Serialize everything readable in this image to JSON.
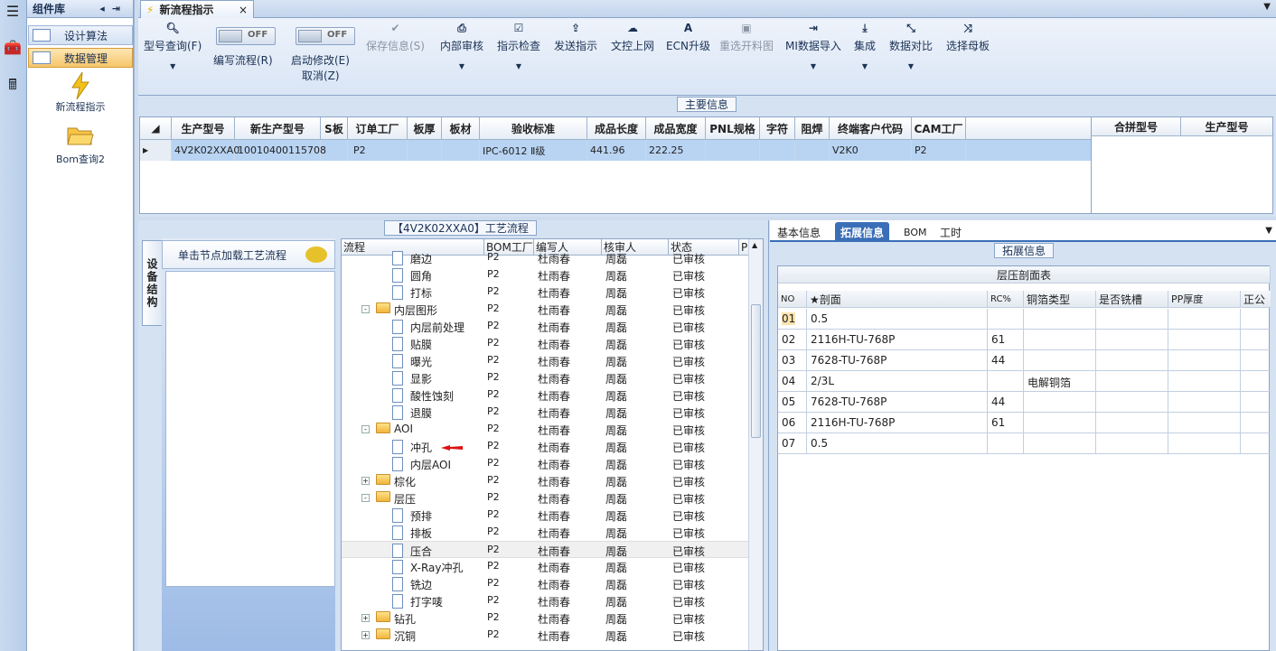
{
  "rail": {
    "icons": [
      "menu-icon",
      "toolbox-icon",
      "calculator-icon"
    ]
  },
  "components": {
    "title": "组件库",
    "nav": [
      {
        "label": "设计算法"
      },
      {
        "label": "数据管理"
      }
    ],
    "tools": [
      {
        "label": "新流程指示",
        "icon": "lightning-icon"
      },
      {
        "label": "Bom查询2",
        "icon": "folder-open-icon"
      }
    ]
  },
  "doc_tab": {
    "title": "新流程指示",
    "close": "×"
  },
  "ribbon": {
    "model_query": "型号查询(F)",
    "edit_toggle": {
      "state": "OFF",
      "label": "编写流程(R)"
    },
    "start_toggle": {
      "state": "OFF",
      "label": "启动修改(E)",
      "label2": "取消(Z)"
    },
    "buttons": [
      {
        "label": "保存信息(S)",
        "icon": "check-icon",
        "enabled": false
      },
      {
        "label": "内部审核",
        "icon": "printer-icon",
        "enabled": true
      },
      {
        "label": "指示检查",
        "icon": "checkbox-icon",
        "enabled": true
      },
      {
        "label": "发送指示",
        "icon": "upload-icon",
        "enabled": true
      },
      {
        "label": "文控上网",
        "icon": "cloud-icon",
        "enabled": true
      },
      {
        "label": "ECN升级",
        "icon": "ecn-icon",
        "enabled": true
      },
      {
        "label": "重选开料图",
        "icon": "image-icon",
        "enabled": false
      },
      {
        "label": "MI数据导入",
        "icon": "import-icon",
        "enabled": true
      },
      {
        "label": "集成",
        "icon": "download-icon",
        "enabled": true
      },
      {
        "label": "数据对比",
        "icon": "compare-icon",
        "enabled": true
      },
      {
        "label": "选择母板",
        "icon": "shuffle-icon",
        "enabled": true
      }
    ]
  },
  "main_info": {
    "title": "主要信息",
    "columns": [
      "生产型号",
      "新生产型号",
      "S板",
      "订单工厂",
      "板厚",
      "板材",
      "验收标准",
      "成品长度",
      "成品宽度",
      "PNL规格",
      "字符",
      "阻焊",
      "终端客户代码",
      "CAM工厂"
    ],
    "row": [
      "4V2K02XXA0",
      "10010400115708",
      "",
      "P2",
      "",
      "",
      "IPC-6012 Ⅱ级",
      "441.96",
      "222.25",
      "",
      "",
      "",
      "V2K0",
      "P2"
    ],
    "side_columns": [
      "合拼型号",
      "生产型号"
    ]
  },
  "process": {
    "title": "【4V2K02XXA0】工艺流程",
    "vtab": "设备结构",
    "load_btn": "单击节点加载工艺流程",
    "columns": [
      "流程",
      "BOM工厂",
      "编写人",
      "核审人",
      "状态",
      "P"
    ],
    "rows": [
      {
        "name": "磨边",
        "level": 2,
        "type": "doc",
        "factory": "P2",
        "writer": "杜雨春",
        "reviewer": "周磊",
        "status": "已审核"
      },
      {
        "name": "圆角",
        "level": 2,
        "type": "doc",
        "factory": "P2",
        "writer": "杜雨春",
        "reviewer": "周磊",
        "status": "已审核"
      },
      {
        "name": "打标",
        "level": 2,
        "type": "doc",
        "factory": "P2",
        "writer": "杜雨春",
        "reviewer": "周磊",
        "status": "已审核"
      },
      {
        "name": "内层图形",
        "level": 1,
        "type": "folder",
        "exp": "-",
        "factory": "P2",
        "writer": "杜雨春",
        "reviewer": "周磊",
        "status": "已审核"
      },
      {
        "name": "内层前处理",
        "level": 2,
        "type": "doc",
        "factory": "P2",
        "writer": "杜雨春",
        "reviewer": "周磊",
        "status": "已审核"
      },
      {
        "name": "贴膜",
        "level": 2,
        "type": "doc",
        "factory": "P2",
        "writer": "杜雨春",
        "reviewer": "周磊",
        "status": "已审核"
      },
      {
        "name": "曝光",
        "level": 2,
        "type": "doc",
        "factory": "P2",
        "writer": "杜雨春",
        "reviewer": "周磊",
        "status": "已审核"
      },
      {
        "name": "显影",
        "level": 2,
        "type": "doc",
        "factory": "P2",
        "writer": "杜雨春",
        "reviewer": "周磊",
        "status": "已审核"
      },
      {
        "name": "酸性蚀刻",
        "level": 2,
        "type": "doc",
        "factory": "P2",
        "writer": "杜雨春",
        "reviewer": "周磊",
        "status": "已审核"
      },
      {
        "name": "退膜",
        "level": 2,
        "type": "doc",
        "factory": "P2",
        "writer": "杜雨春",
        "reviewer": "周磊",
        "status": "已审核"
      },
      {
        "name": "AOI",
        "level": 1,
        "type": "folder",
        "exp": "-",
        "factory": "P2",
        "writer": "杜雨春",
        "reviewer": "周磊",
        "status": "已审核"
      },
      {
        "name": "冲孔",
        "level": 2,
        "type": "doc",
        "factory": "P2",
        "writer": "杜雨春",
        "reviewer": "周磊",
        "status": "已审核"
      },
      {
        "name": "内层AOI",
        "level": 2,
        "type": "doc",
        "factory": "P2",
        "writer": "杜雨春",
        "reviewer": "周磊",
        "status": "已审核"
      },
      {
        "name": "棕化",
        "level": 1,
        "type": "folder",
        "exp": "+",
        "factory": "P2",
        "writer": "杜雨春",
        "reviewer": "周磊",
        "status": "已审核"
      },
      {
        "name": "层压",
        "level": 1,
        "type": "folder",
        "exp": "-",
        "factory": "P2",
        "writer": "杜雨春",
        "reviewer": "周磊",
        "status": "已审核"
      },
      {
        "name": "预排",
        "level": 2,
        "type": "doc",
        "factory": "P2",
        "writer": "杜雨春",
        "reviewer": "周磊",
        "status": "已审核"
      },
      {
        "name": "排板",
        "level": 2,
        "type": "doc",
        "factory": "P2",
        "writer": "杜雨春",
        "reviewer": "周磊",
        "status": "已审核"
      },
      {
        "name": "压合",
        "level": 2,
        "type": "doc",
        "factory": "P2",
        "writer": "杜雨春",
        "reviewer": "周磊",
        "status": "已审核",
        "selected": true
      },
      {
        "name": "X-Ray冲孔",
        "level": 2,
        "type": "doc",
        "factory": "P2",
        "writer": "杜雨春",
        "reviewer": "周磊",
        "status": "已审核"
      },
      {
        "name": "铣边",
        "level": 2,
        "type": "doc",
        "factory": "P2",
        "writer": "杜雨春",
        "reviewer": "周磊",
        "status": "已审核"
      },
      {
        "name": "打字唛",
        "level": 2,
        "type": "doc",
        "factory": "P2",
        "writer": "杜雨春",
        "reviewer": "周磊",
        "status": "已审核"
      },
      {
        "name": "钻孔",
        "level": 1,
        "type": "folder",
        "exp": "+",
        "factory": "P2",
        "writer": "杜雨春",
        "reviewer": "周磊",
        "status": "已审核"
      },
      {
        "name": "沉铜",
        "level": 1,
        "type": "folder",
        "exp": "+",
        "factory": "P2",
        "writer": "杜雨春",
        "reviewer": "周磊",
        "status": "已审核"
      }
    ]
  },
  "right": {
    "tabs": [
      "基本信息",
      "拓展信息",
      "BOM",
      "工时"
    ],
    "active_tab": 1,
    "group_title": "拓展信息",
    "table_title": "层压剖面表",
    "columns": [
      "NO",
      "★剖面",
      "RC%",
      "铜箔类型",
      "是否铣槽",
      "PP厚度",
      "正公"
    ],
    "rows": [
      [
        "01",
        "0.5",
        "",
        "",
        "",
        "",
        ""
      ],
      [
        "02",
        "2116H-TU-768P",
        "61",
        "",
        "",
        "",
        ""
      ],
      [
        "03",
        "7628-TU-768P",
        "44",
        "",
        "",
        "",
        ""
      ],
      [
        "04",
        "2/3L",
        "",
        "电解铜箔",
        "",
        "",
        ""
      ],
      [
        "05",
        "7628-TU-768P",
        "44",
        "",
        "",
        "",
        ""
      ],
      [
        "06",
        "2116H-TU-768P",
        "61",
        "",
        "",
        "",
        ""
      ],
      [
        "07",
        "0.5",
        "",
        "",
        "",
        "",
        ""
      ]
    ]
  }
}
